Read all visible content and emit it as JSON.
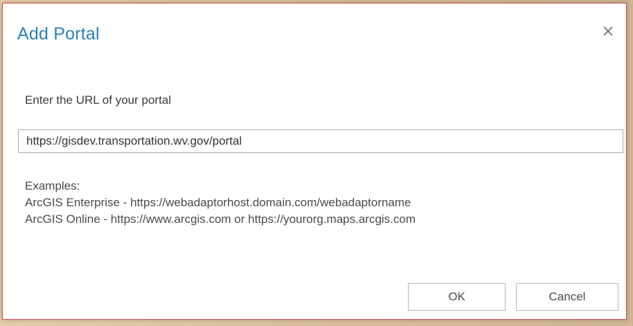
{
  "dialog": {
    "title": "Add Portal",
    "close_icon": "close-icon",
    "prompt": "Enter the URL of your portal",
    "url_value": "https://gisdev.transportation.wv.gov/portal",
    "examples": {
      "heading": "Examples:",
      "enterprise": "ArcGIS Enterprise - https://webadaptorhost.domain.com/webadaptorname",
      "online": "ArcGIS Online - https://www.arcgis.com or https://yourorg.maps.arcgis.com"
    },
    "ok_label": "OK",
    "cancel_label": "Cancel"
  },
  "colors": {
    "title": "#2c7fb8",
    "border": "#d24a4a",
    "text": "#3b3b3b"
  }
}
